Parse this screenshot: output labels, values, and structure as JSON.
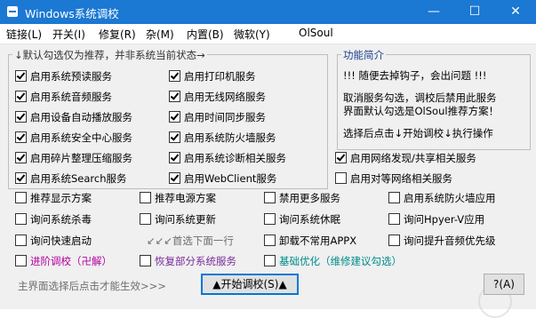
{
  "window": {
    "title": "Windows系统调校",
    "minimize": "—",
    "maximize": "☐",
    "close": "✕"
  },
  "menu": {
    "items": [
      "链接(L)",
      "开关(I)",
      "修复(R)",
      "杂(M)",
      "内置(B)",
      "微软(Y)"
    ],
    "brand": "OlSoul"
  },
  "group1": {
    "title": "↓默认勾选仅为推荐，并非系统当前状态→",
    "options": [
      {
        "label": "启用系统预读服务",
        "checked": true
      },
      {
        "label": "启用系统音频服务",
        "checked": true
      },
      {
        "label": "启用设备自动播放服务",
        "checked": true
      },
      {
        "label": "启用系统安全中心服务",
        "checked": true
      },
      {
        "label": "启用碎片整理压缩服务",
        "checked": true
      },
      {
        "label": "启用系统Search服务",
        "checked": true
      },
      {
        "label": "启用打印机服务",
        "checked": true
      },
      {
        "label": "启用无线网络服务",
        "checked": true
      },
      {
        "label": "启用时间同步服务",
        "checked": true
      },
      {
        "label": "启用系统防火墙服务",
        "checked": true
      },
      {
        "label": "启用系统诊断相关服务",
        "checked": true
      },
      {
        "label": "启用WebClient服务",
        "checked": true
      }
    ]
  },
  "intro": {
    "title": "功能简介",
    "line1": "!!! 随便去掉钩子，会出问题 !!!",
    "line2": "取消服务勾选，调校后禁用此服务",
    "line3": "界面默认勾选是OlSoul推荐方案！",
    "line4": "选择后点击↓开始调校↓执行操作"
  },
  "extra_options": [
    {
      "label": "启用网络发现/共享相关服务",
      "checked": true
    },
    {
      "label": "启用对等网络相关服务",
      "checked": false
    }
  ],
  "options_grid": [
    {
      "label": "推荐显示方案",
      "checked": false
    },
    {
      "label": "推荐电源方案",
      "checked": false
    },
    {
      "label": "禁用更多服务",
      "checked": false
    },
    {
      "label": "启用系统防火墙应用",
      "checked": false
    },
    {
      "label": "询问系统杀毒",
      "checked": false
    },
    {
      "label": "询问系统更新",
      "checked": false
    },
    {
      "label": "询问系统休眠",
      "checked": false
    },
    {
      "label": "询问Hpyer-V应用",
      "checked": false
    },
    {
      "label": "询问快速启动",
      "checked": false
    },
    {
      "label": "卸载不常用APPX",
      "checked": false
    },
    {
      "label": "询问提升音频优先级",
      "checked": false
    }
  ],
  "hint_first": "↙↙↙首选下面一行",
  "bottom_options": [
    {
      "label": "进阶调校（卍解）",
      "checked": false,
      "color": "#b4009e"
    },
    {
      "label": "恢复部分系统服务",
      "checked": false,
      "color": "#7a2a9c"
    },
    {
      "label": "基础优化（维修建议勾选）",
      "checked": false,
      "color": "#008b8b"
    }
  ],
  "footer": {
    "hint": "主界面选择后点击才能生效>>>",
    "start_button": "▲开始调校(S)▲",
    "help_button": "?(A)"
  },
  "colors": {
    "titlebar": "#1b78d3",
    "panel": "#f0f0f0",
    "hint_gray": "#6d6d6d"
  }
}
